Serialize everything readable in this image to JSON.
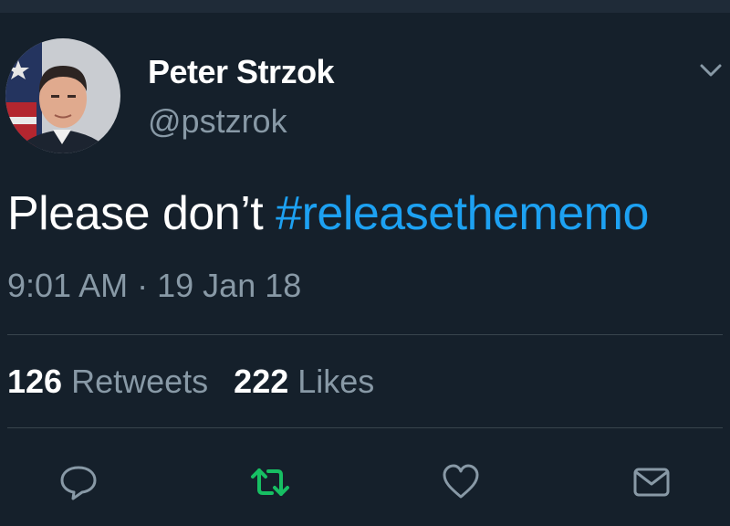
{
  "tweet": {
    "display_name": "Peter Strzok",
    "handle": "@pstzrok",
    "text_plain": "Please don’t ",
    "text_hashtag": "#releasethememo",
    "time": "9:01 AM",
    "separator": "·",
    "date": "19 Jan 18"
  },
  "stats": {
    "retweets_count": "126",
    "retweets_label": "Retweets",
    "likes_count": "222",
    "likes_label": "Likes"
  },
  "icons": {
    "menu": "chevron-down-icon",
    "reply": "reply-icon",
    "retweet": "retweet-icon",
    "like": "heart-icon",
    "share": "mail-icon"
  },
  "colors": {
    "background": "#15202b",
    "hashtag": "#1da1f2",
    "secondary_text": "#8899a6",
    "retweet_active": "#17bf63",
    "divider": "#38444d"
  }
}
